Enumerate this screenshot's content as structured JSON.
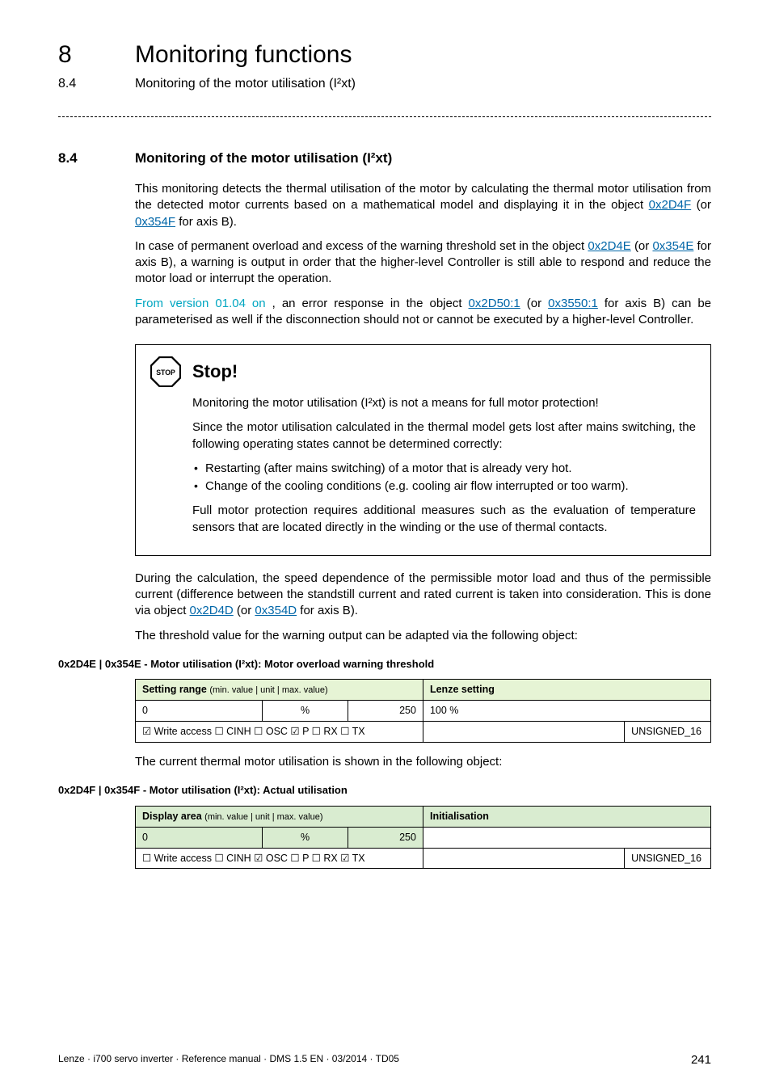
{
  "header": {
    "chapter_number": "8",
    "chapter_title": "Monitoring functions",
    "sub_number": "8.4",
    "sub_title": "Monitoring of the motor utilisation (I²xt)"
  },
  "section": {
    "number": "8.4",
    "title": "Monitoring of the motor utilisation (I²xt)"
  },
  "paras": {
    "p1_pre": "This monitoring detects the thermal utilisation of the motor by calculating the thermal motor utilisation from the detected motor currents based on a mathematical model and displaying it in the object ",
    "p1_link1": "0x2D4F",
    "p1_mid": " (or ",
    "p1_link2": "0x354F",
    "p1_post": " for axis B).",
    "p2_pre": "In case of permanent overload and excess of the warning threshold set in the object ",
    "p2_link1": "0x2D4E",
    "p2_mid": " (or ",
    "p2_link2": "0x354E",
    "p2_post": " for axis B), a warning is output in order that the higher-level Controller is still able to respond and reduce the motor load or interrupt the operation.",
    "p3_cyan": "From version 01.04 on",
    "p3_mid1": ", an error response in the object ",
    "p3_link1": "0x2D50:1",
    "p3_mid2": " (or ",
    "p3_link2": "0x3550:1",
    "p3_post": " for axis B) can be parameterised as well if the disconnection should not or cannot be executed by a higher-level Controller."
  },
  "stop": {
    "icon_text": "STOP",
    "label": "Stop!",
    "p1": "Monitoring the motor utilisation (I²xt) is not a means for full motor protection!",
    "p2": "Since the motor utilisation calculated in the thermal model gets lost after mains switching, the following operating states cannot be determined correctly:",
    "li1": "Restarting (after mains switching) of a motor that is already very hot.",
    "li2": "Change of the cooling conditions (e.g. cooling air flow interrupted or too warm).",
    "p3": "Full motor protection requires additional measures such as the evaluation of temperature sensors that are located directly in the winding or the use of thermal contacts."
  },
  "after_stop": {
    "p1_pre": "During the calculation, the speed dependence of the permissible motor load and thus of the permissible current (difference between the standstill current and rated current is taken into consideration. This is done via object ",
    "p1_link1": "0x2D4D",
    "p1_mid": " (or ",
    "p1_link2": "0x354D",
    "p1_post": " for axis B).",
    "p2": "The threshold value for the warning output can be adapted via the following object:"
  },
  "table1": {
    "caption": "0x2D4E | 0x354E - Motor utilisation (I²xt): Motor overload warning threshold",
    "head_left": "Setting range",
    "head_left_sub": "(min. value | unit | max. value)",
    "head_right": "Lenze setting",
    "row_min": "0",
    "row_unit": "%",
    "row_max": "250",
    "row_init": "100 %",
    "row_access": "☑ Write access   ☐ CINH   ☐ OSC   ☑ P   ☐ RX   ☐ TX",
    "row_type": "UNSIGNED_16"
  },
  "mid_line": "The current thermal motor utilisation is shown in the following object:",
  "table2": {
    "caption": "0x2D4F | 0x354F - Motor utilisation (I²xt): Actual utilisation",
    "head_left": "Display area",
    "head_left_sub": "(min. value | unit | max. value)",
    "head_right": "Initialisation",
    "row_min": "0",
    "row_unit": "%",
    "row_max": "250",
    "row_init": "",
    "row_access": "☐ Write access   ☐ CINH   ☑ OSC   ☐ P   ☐ RX   ☑ TX",
    "row_type": "UNSIGNED_16"
  },
  "footer": {
    "left": "Lenze · i700 servo inverter · Reference manual · DMS 1.5 EN · 03/2014 · TD05",
    "page": "241"
  }
}
